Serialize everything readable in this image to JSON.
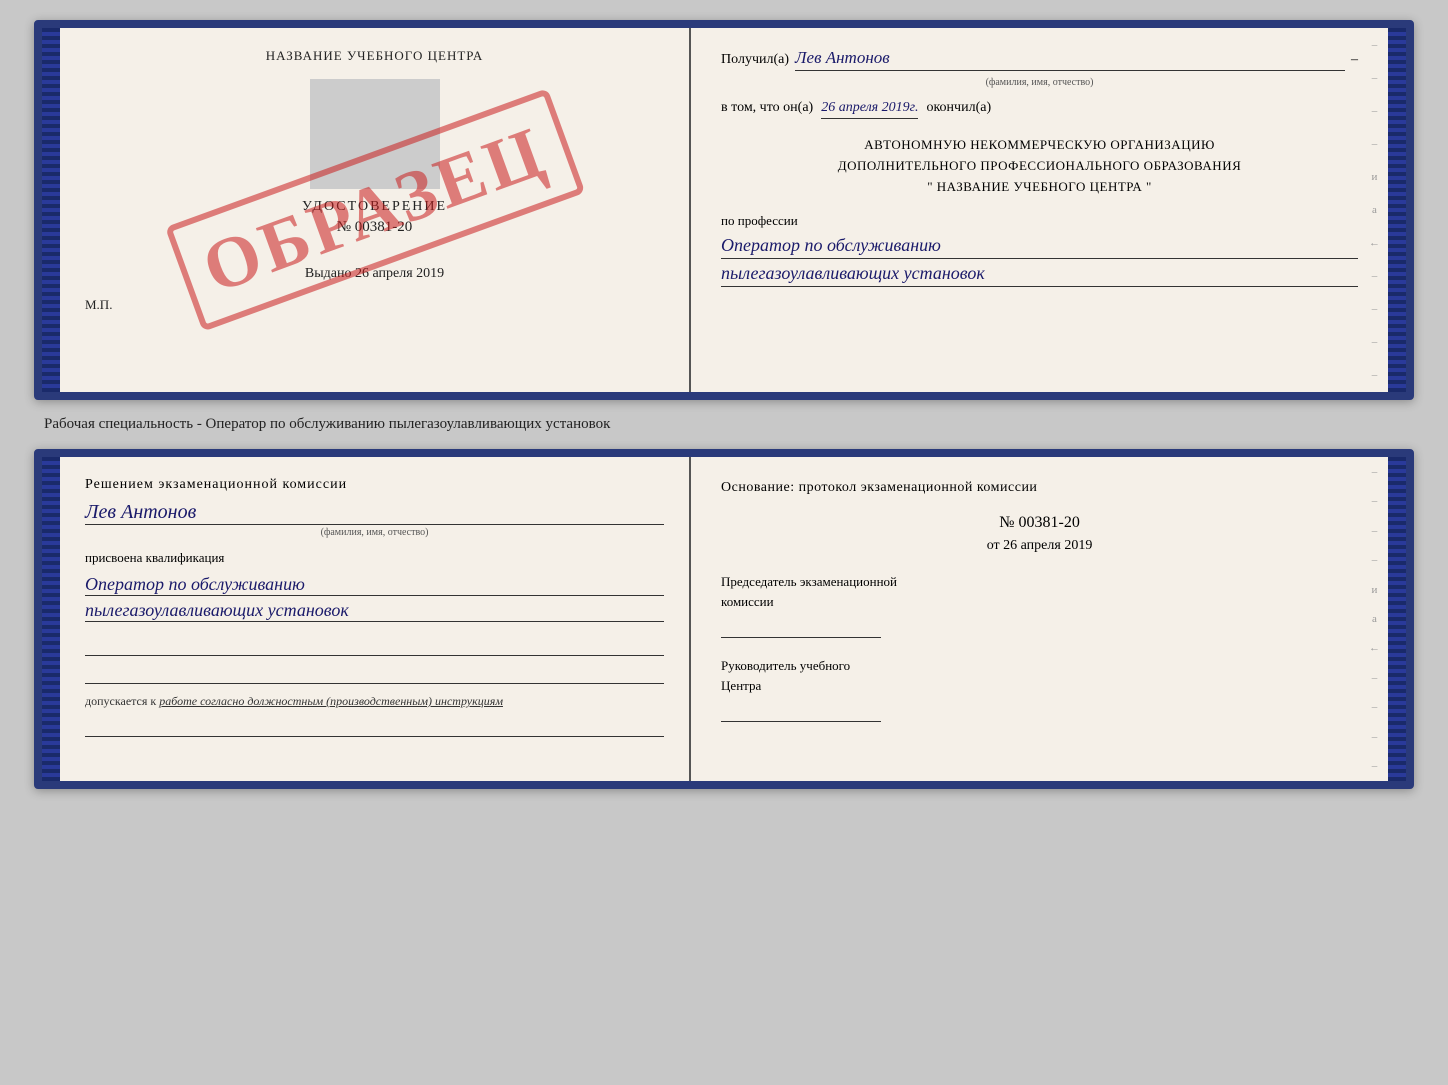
{
  "top_diploma": {
    "left": {
      "school_name": "НАЗВАНИЕ УЧЕБНОГО ЦЕНТРА",
      "udostoverenie": "УДОСТОВЕРЕНИЕ",
      "number": "№ 00381-20",
      "vydano": "Выдано",
      "vydano_date": "26 апреля 2019",
      "mp": "М.П.",
      "stamp": "ОБРАЗЕЦ"
    },
    "right": {
      "poluchil_label": "Получил(а)",
      "recipient_name": "Лев Антонов",
      "fio_subtitle": "(фамилия, имя, отчество)",
      "vtom_label": "в том, что он(а)",
      "vtom_date": "26 апреля 2019г.",
      "okonchil": "окончил(а)",
      "org_line1": "АВТОНОМНУЮ НЕКОММЕРЧЕСКУЮ ОРГАНИЗАЦИЮ",
      "org_line2": "ДОПОЛНИТЕЛЬНОГО ПРОФЕССИОНАЛЬНОГО ОБРАЗОВАНИЯ",
      "org_line3": "\"  НАЗВАНИЕ УЧЕБНОГО ЦЕНТРА  \"",
      "po_professii": "по профессии",
      "profession1": "Оператор по обслуживанию",
      "profession2": "пылегазоулавливающих установок",
      "margin_marks": [
        "-",
        "-",
        "-",
        "-",
        "и",
        "а",
        "←",
        "-",
        "-",
        "-",
        "-"
      ]
    }
  },
  "middle": {
    "text": "Рабочая специальность - Оператор по обслуживанию пылегазоулавливающих установок"
  },
  "bottom_diploma": {
    "left": {
      "resheniem": "Решением экзаменационной комиссии",
      "person_name": "Лев Антонов",
      "fio_subtitle": "(фамилия, имя, отчество)",
      "prisvoena": "присвоена квалификация",
      "qualification1": "Оператор по обслуживанию",
      "qualification2": "пылегазоулавливающих установок",
      "dopusk_prefix": "допускается к",
      "dopusk_italic": "работе согласно должностным (производственным) инструкциям"
    },
    "right": {
      "osnovanie": "Основание: протокол экзаменационной комиссии",
      "protocol_number": "№ 00381-20",
      "ot_label": "от",
      "ot_date": "26 апреля 2019",
      "predsedatel_line1": "Председатель экзаменационной",
      "predsedatel_line2": "комиссии",
      "rukovoditel_line1": "Руководитель учебного",
      "rukovoditel_line2": "Центра",
      "margin_marks": [
        "-",
        "-",
        "-",
        "-",
        "и",
        "а",
        "←",
        "-",
        "-",
        "-",
        "-"
      ]
    }
  }
}
